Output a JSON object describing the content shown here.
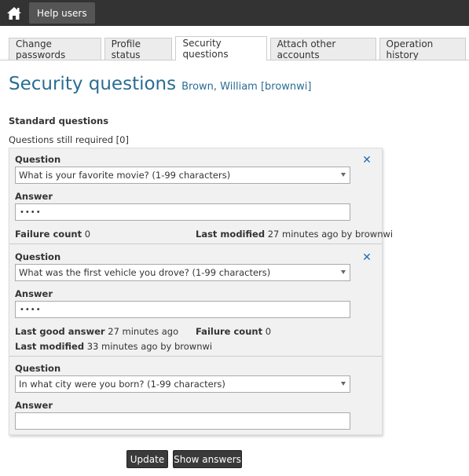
{
  "topbar": {
    "help_users_label": "Help users"
  },
  "tabs": [
    {
      "label": "Change passwords"
    },
    {
      "label": "Profile status"
    },
    {
      "label": "Security questions",
      "active": true
    },
    {
      "label": "Attach other accounts"
    },
    {
      "label": "Operation history"
    }
  ],
  "page": {
    "title": "Security questions",
    "user": "Brown, William [brownwi]",
    "standard_label": "Standard questions",
    "required_label": "Questions still required [0]"
  },
  "labels": {
    "question": "Question",
    "answer": "Answer",
    "failure_count": "Failure count",
    "last_modified": "Last modified",
    "last_good_answer": "Last good answer"
  },
  "questions": [
    {
      "question": "What is your favorite movie? (1-99 characters)",
      "answer": "••••",
      "failure_count": "0",
      "last_modified": "27 minutes ago by brownwi"
    },
    {
      "question": "What was the first vehicle you drove? (1-99 characters)",
      "answer": "••••",
      "last_good_answer": "27 minutes ago",
      "failure_count": "0",
      "last_modified": "33 minutes ago by brownwi"
    },
    {
      "question": "In what city were you born? (1-99 characters)",
      "answer": ""
    }
  ],
  "buttons": {
    "update": "Update",
    "show_answers": "Show answers"
  },
  "icons": {
    "home": "home-icon",
    "remove": "remove-icon"
  },
  "colors": {
    "accent": "#2a6d94",
    "remove": "#1f6eb5",
    "topbar": "#333333"
  }
}
